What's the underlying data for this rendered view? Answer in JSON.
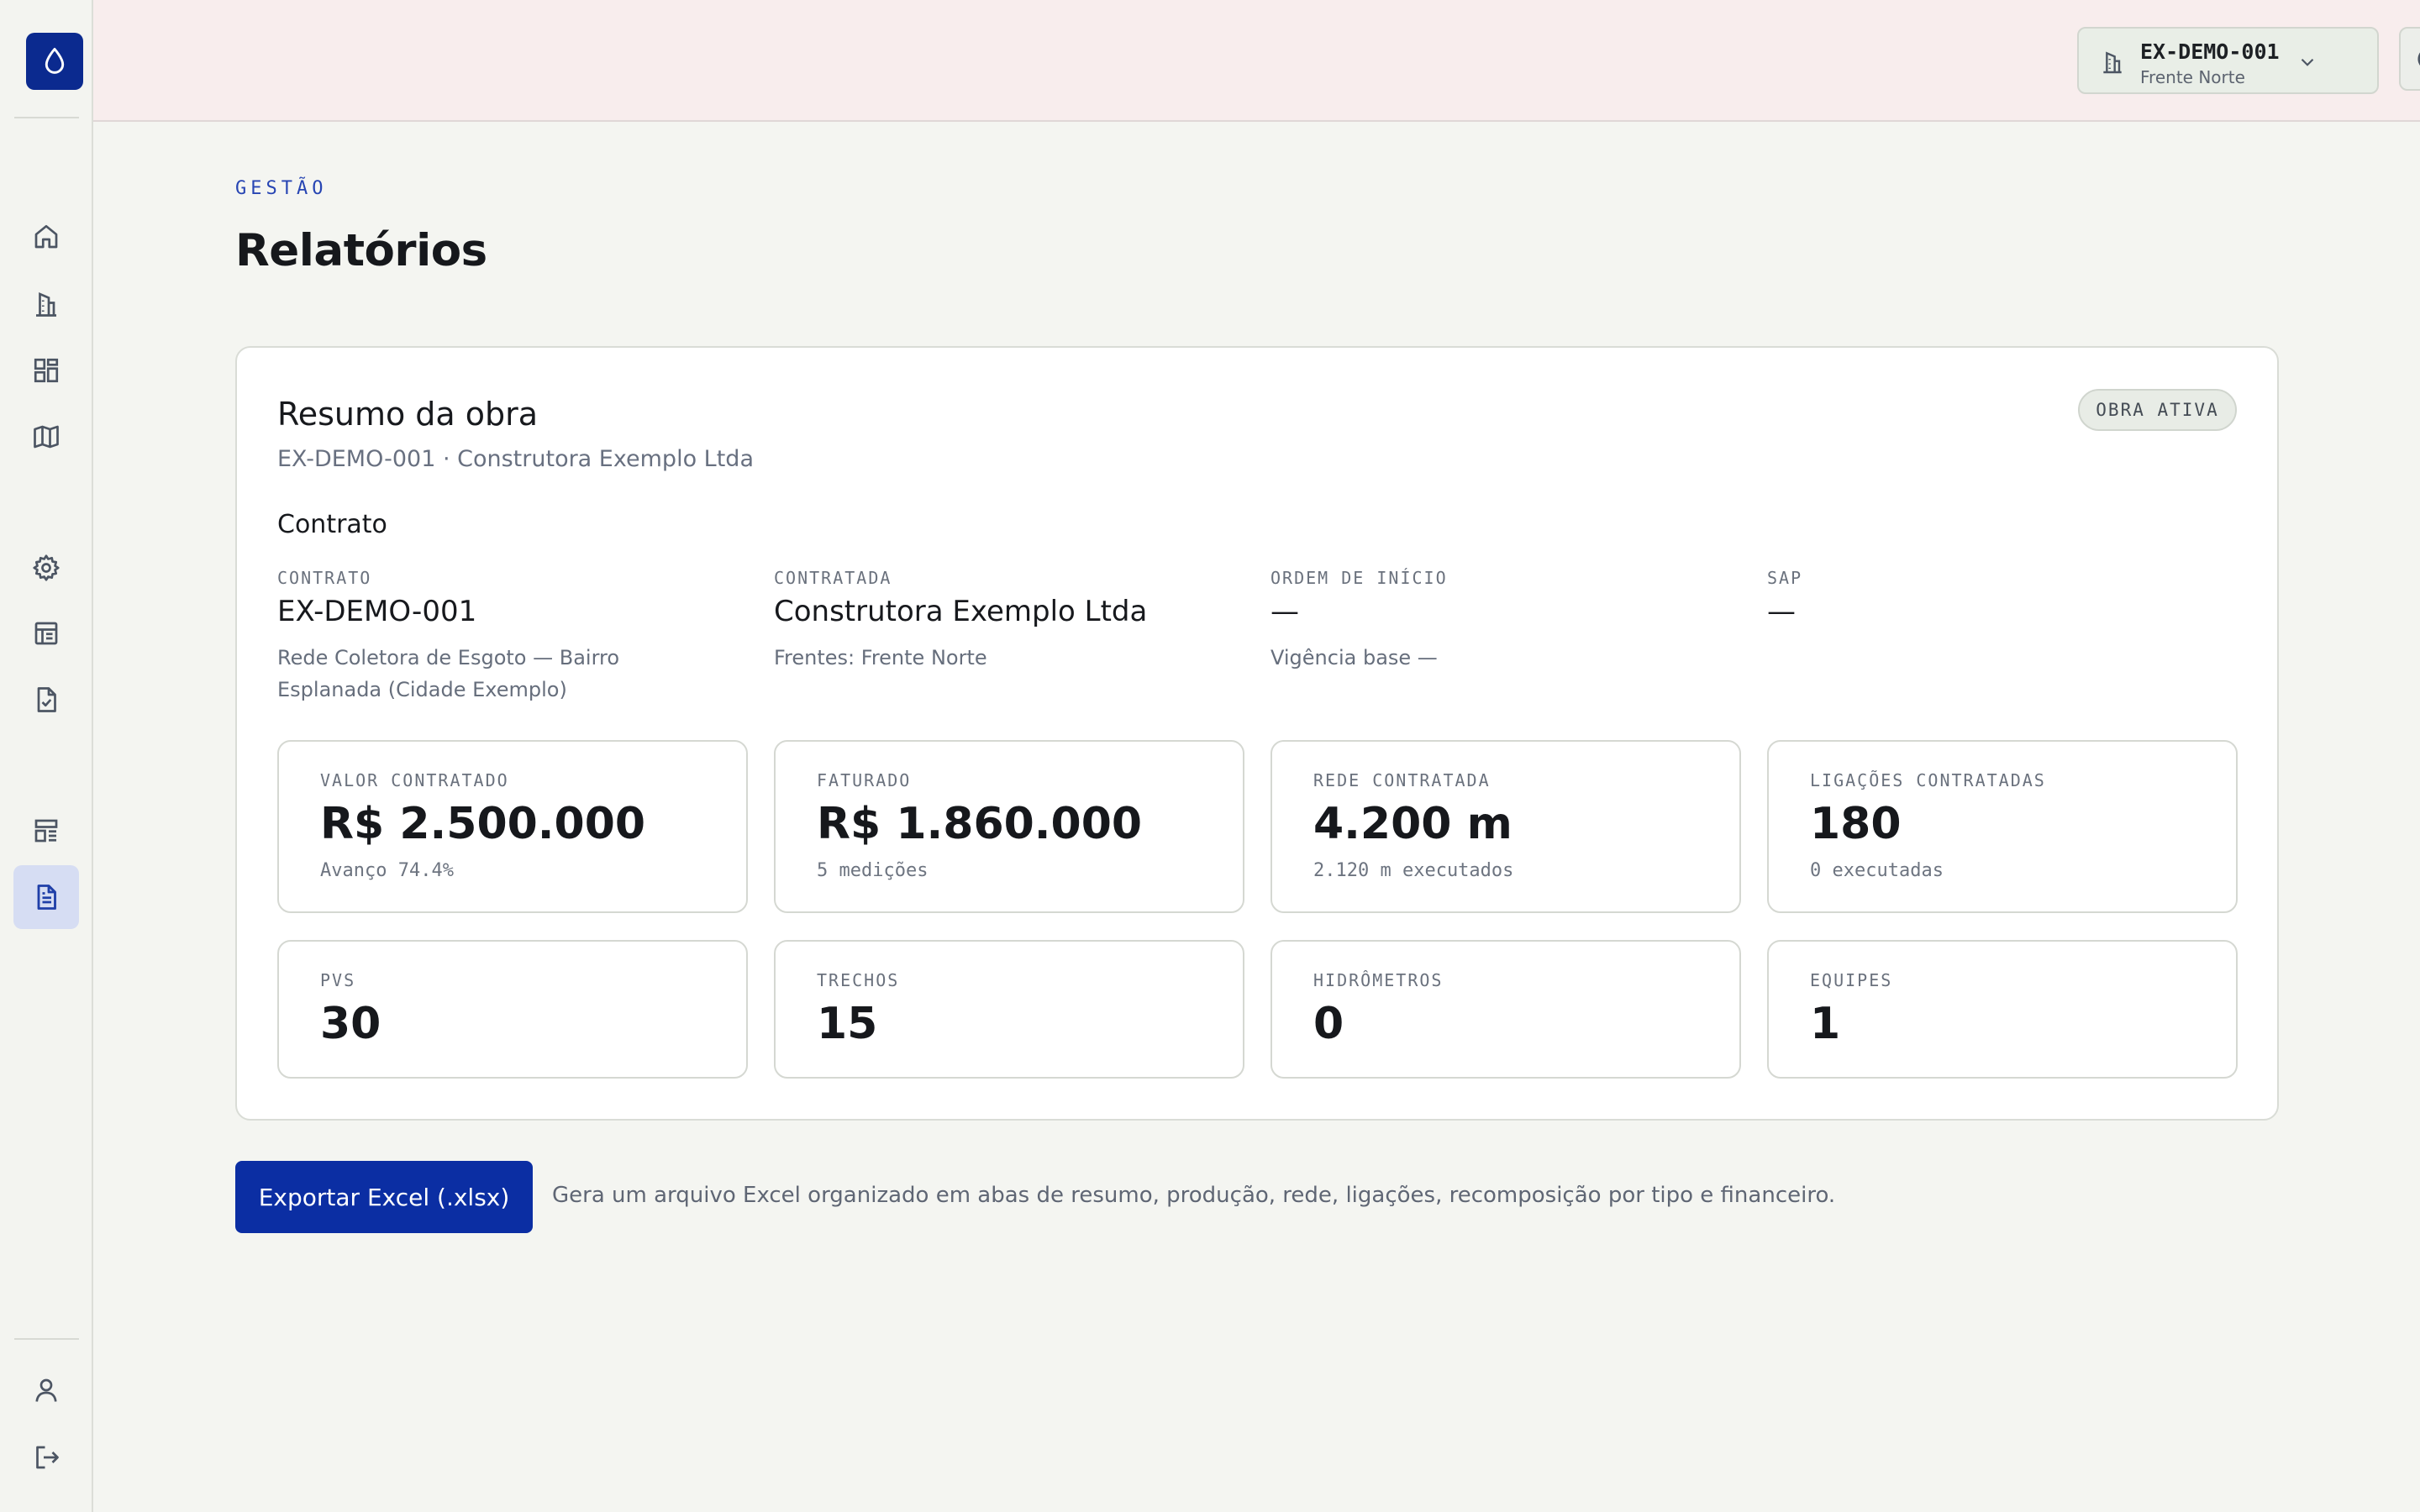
{
  "colors": {
    "brand": "#0b2a8f",
    "accent": "#2745b3",
    "button": "#0b2ea3"
  },
  "sidebar": {
    "logo_icon": "water-drop-icon",
    "items": [
      {
        "name": "home-icon",
        "active": false
      },
      {
        "name": "building-icon",
        "active": false
      },
      {
        "name": "dashboard-icon",
        "active": false
      },
      {
        "name": "map-icon",
        "active": false
      },
      {
        "name": "gear-icon",
        "active": false
      },
      {
        "name": "table-icon",
        "active": false
      },
      {
        "name": "file-check-icon",
        "active": false
      },
      {
        "name": "layout-icon",
        "active": false
      },
      {
        "name": "file-text-icon",
        "active": true
      }
    ],
    "bottom": [
      {
        "name": "user-icon"
      },
      {
        "name": "logout-icon"
      }
    ]
  },
  "header": {
    "project_code": "EX-DEMO-001",
    "project_front": "Frente Norte",
    "theme_icon": "moon-icon"
  },
  "page": {
    "eyebrow": "GESTÃO",
    "title": "Relatórios"
  },
  "summary": {
    "title": "Resumo da obra",
    "subtitle": "EX-DEMO-001 · Construtora Exemplo Ltda",
    "badge": "OBRA ATIVA",
    "section": "Contrato",
    "fields": [
      {
        "label": "CONTRATO",
        "value": "EX-DEMO-001",
        "note": "Rede Coletora de Esgoto — Bairro Esplanada (Cidade Exemplo)"
      },
      {
        "label": "CONTRATADA",
        "value": "Construtora Exemplo Ltda",
        "note": "Frentes: Frente Norte"
      },
      {
        "label": "ORDEM DE INÍCIO",
        "value": "—",
        "note": "Vigência base —"
      },
      {
        "label": "SAP",
        "value": "—",
        "note": ""
      }
    ],
    "stats": [
      {
        "label": "VALOR CONTRATADO",
        "value": "R$ 2.500.000",
        "note": "Avanço 74.4%"
      },
      {
        "label": "FATURADO",
        "value": "R$ 1.860.000",
        "note": "5 medições"
      },
      {
        "label": "REDE CONTRATADA",
        "value": "4.200 m",
        "note": "2.120 m executados"
      },
      {
        "label": "LIGAÇÕES CONTRATADAS",
        "value": "180",
        "note": "0 executadas"
      },
      {
        "label": "PVS",
        "value": "30",
        "note": ""
      },
      {
        "label": "TRECHOS",
        "value": "15",
        "note": ""
      },
      {
        "label": "HIDRÔMETROS",
        "value": "0",
        "note": ""
      },
      {
        "label": "EQUIPES",
        "value": "1",
        "note": ""
      }
    ]
  },
  "export": {
    "button_label": "Exportar Excel (.xlsx)",
    "description": "Gera um arquivo Excel organizado em abas de resumo, produção, rede, ligações, recomposição por tipo e financeiro."
  }
}
